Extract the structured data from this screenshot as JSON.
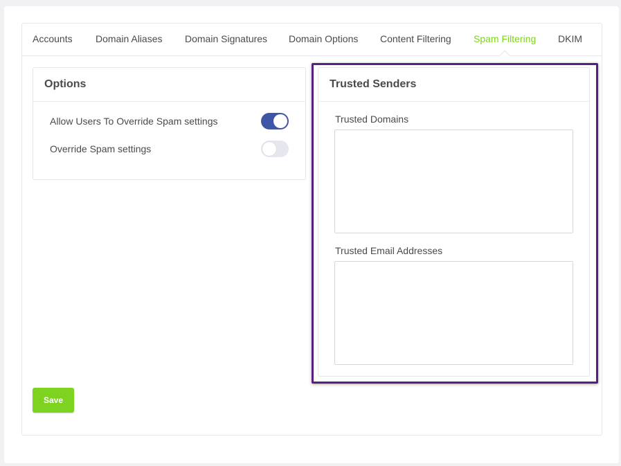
{
  "tabs": [
    {
      "label": "Accounts"
    },
    {
      "label": "Domain Aliases"
    },
    {
      "label": "Domain Signatures"
    },
    {
      "label": "Domain Options"
    },
    {
      "label": "Content Filtering"
    },
    {
      "label": "Spam Filtering"
    },
    {
      "label": "DKIM"
    }
  ],
  "active_tab": "Spam Filtering",
  "options": {
    "title": "Options",
    "items": [
      {
        "label": "Allow Users To Override Spam settings",
        "enabled": true
      },
      {
        "label": "Override Spam settings",
        "enabled": false
      }
    ]
  },
  "trusted_senders": {
    "title": "Trusted Senders",
    "domains_label": "Trusted Domains",
    "domains_value": "",
    "emails_label": "Trusted Email Addresses",
    "emails_value": ""
  },
  "save_label": "Save",
  "colors": {
    "accent": "#7ed321",
    "toggle_on": "#3f55a5",
    "highlight": "#5a1f7e"
  }
}
